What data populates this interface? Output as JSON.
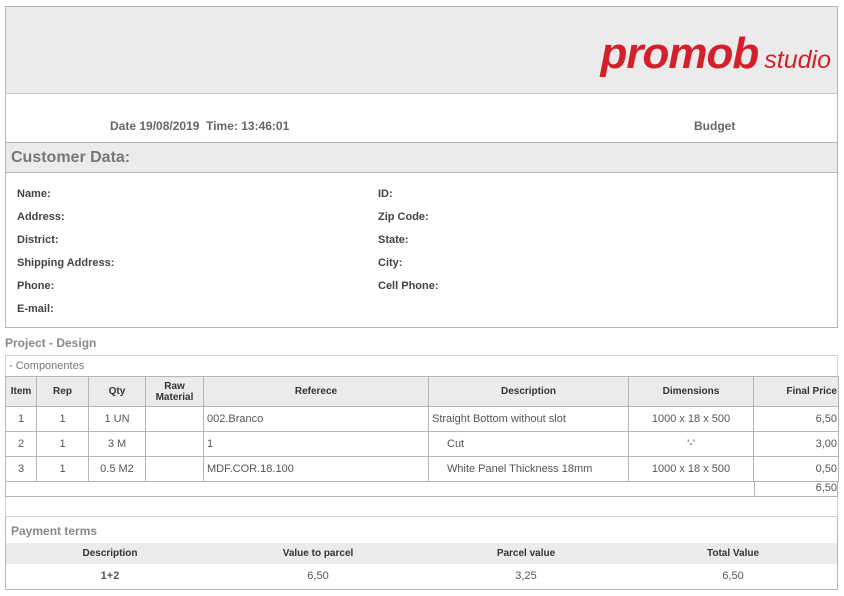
{
  "header": {
    "brand": "promob",
    "brand_sub": "studio"
  },
  "meta": {
    "date_label": "Date",
    "date": "19/08/2019",
    "time_label": "Time:",
    "time": "13:46:01",
    "doc_type": "Budget"
  },
  "customer": {
    "title": "Customer Data:",
    "left_fields": [
      "Name:",
      "Address:",
      "District:",
      "Shipping Address:",
      "Phone:",
      "E-mail:"
    ],
    "right_fields": [
      "ID:",
      "Zip Code:",
      "State:",
      "City:",
      "Cell Phone:"
    ]
  },
  "project": {
    "title": "Project - Design",
    "section": "- Componentes",
    "columns": [
      "Item",
      "Rep",
      "Qty",
      "Raw Material",
      "Referece",
      "Description",
      "Dimensions",
      "Final Price"
    ],
    "rows": [
      {
        "item": "1",
        "rep": "1",
        "qty": "1 UN",
        "raw": "",
        "ref": "002.Branco",
        "desc": "Straight Bottom without slot",
        "dim": "1000 x 18 x 500",
        "price": "6,50"
      },
      {
        "item": "2",
        "rep": "1",
        "qty": "3 M",
        "raw": "",
        "ref": "1",
        "desc": "Cut",
        "dim": "'-'",
        "price": "3,00"
      },
      {
        "item": "3",
        "rep": "1",
        "qty": "0.5 M2",
        "raw": "",
        "ref": "MDF.COR.18.100",
        "desc": "White Panel Thickness 18mm",
        "dim": "1000 x 18 x 500",
        "price": "0,50"
      }
    ],
    "total": "6,50"
  },
  "payment": {
    "title": "Payment terms",
    "columns": [
      "Description",
      "Value to parcel",
      "Parcel value",
      "Total Value"
    ],
    "row": [
      "1+2",
      "6,50",
      "3,25",
      "6,50"
    ]
  }
}
